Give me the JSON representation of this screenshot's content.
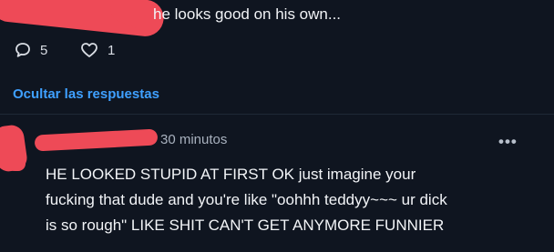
{
  "parent_comment": {
    "text_visible": "he looks good on his own...",
    "reply_count": "5",
    "like_count": "1"
  },
  "replies_toggle": {
    "label": "Ocultar las respuestas"
  },
  "reply": {
    "time": "30 minutos",
    "more_label": "•••",
    "lines": [
      "HE LOOKED STUPID AT FIRST OK just imagine your",
      "fucking that dude and you're like \"oohhh teddyy~~~ ur dick",
      "is so rough\" LIKE SHIT CAN'T GET ANYMORE FUNNIER"
    ]
  },
  "colors": {
    "background": "#0f1520",
    "accent_link": "#3fa0ff",
    "redaction": "#ee4a57"
  }
}
